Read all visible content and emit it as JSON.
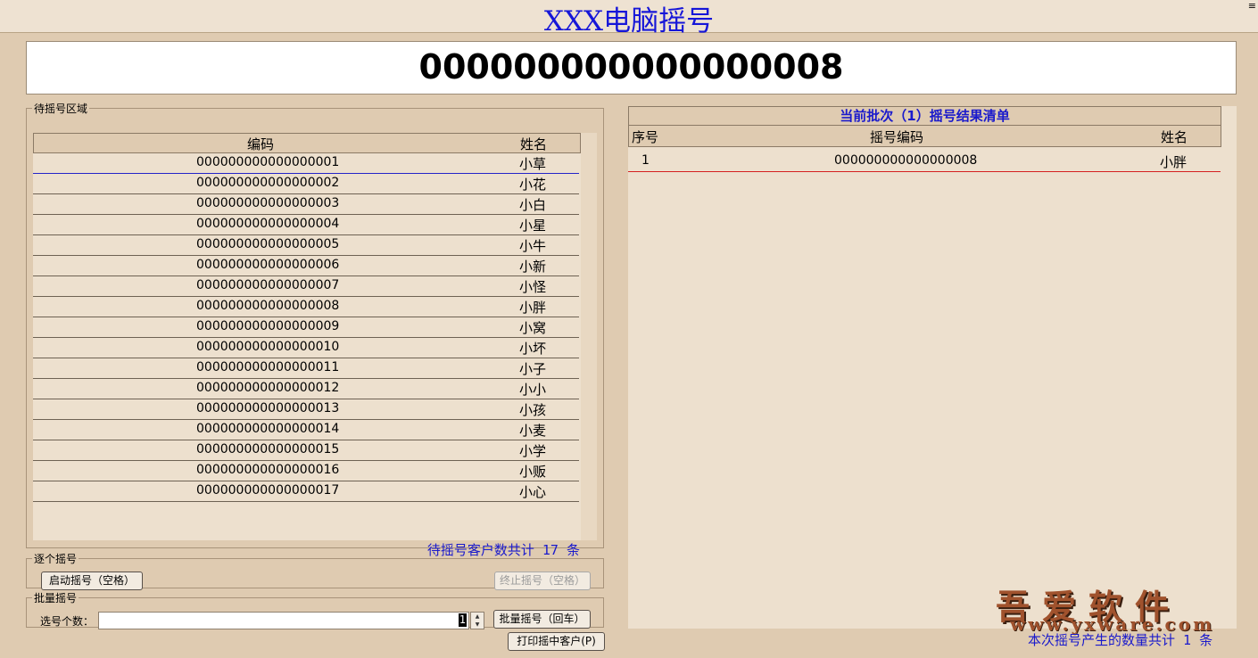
{
  "window": {
    "title": "XXX电脑摇号",
    "corner_mark": "≡"
  },
  "display": {
    "current_number": "000000000000000008"
  },
  "pending": {
    "legend": "待摇号区域",
    "columns": {
      "code": "编码",
      "name": "姓名"
    },
    "rows": [
      {
        "code": "000000000000000001",
        "name": "小草"
      },
      {
        "code": "000000000000000002",
        "name": "小花"
      },
      {
        "code": "000000000000000003",
        "name": "小白"
      },
      {
        "code": "000000000000000004",
        "name": "小星"
      },
      {
        "code": "000000000000000005",
        "name": "小牛"
      },
      {
        "code": "000000000000000006",
        "name": "小新"
      },
      {
        "code": "000000000000000007",
        "name": "小怪"
      },
      {
        "code": "000000000000000008",
        "name": "小胖"
      },
      {
        "code": "000000000000000009",
        "name": "小窝"
      },
      {
        "code": "000000000000000010",
        "name": "小坏"
      },
      {
        "code": "000000000000000011",
        "name": "小子"
      },
      {
        "code": "000000000000000012",
        "name": "小小"
      },
      {
        "code": "000000000000000013",
        "name": "小孩"
      },
      {
        "code": "000000000000000014",
        "name": "小麦"
      },
      {
        "code": "000000000000000015",
        "name": "小学"
      },
      {
        "code": "000000000000000016",
        "name": "小贩"
      },
      {
        "code": "000000000000000017",
        "name": "小心"
      }
    ],
    "count_text": "待摇号客户数共计 17 条"
  },
  "single_draw": {
    "legend": "逐个摇号",
    "start_label": "启动摇号（空格）",
    "stop_label": "终止摇号（空格）"
  },
  "batch_draw": {
    "legend": "批量摇号",
    "count_label": "选号个数：",
    "count_value": "1",
    "batch_label": "批量摇号（回车）"
  },
  "print_label": "打印摇中客户(P)",
  "results": {
    "title": "当前批次（1）摇号结果清单",
    "columns": {
      "seq": "序号",
      "code": "摇号编码",
      "name": "姓名"
    },
    "rows": [
      {
        "seq": "1",
        "code": "000000000000000008",
        "name": "小胖"
      }
    ],
    "count_text": "本次摇号产生的数量共计 1 条"
  },
  "watermark": {
    "cn": "吾爱软件",
    "url": "www.yxware.com"
  },
  "colors": {
    "background": "#dfcbb1",
    "accent_blue": "#1a1acc",
    "highlight_red": "#d42020"
  }
}
